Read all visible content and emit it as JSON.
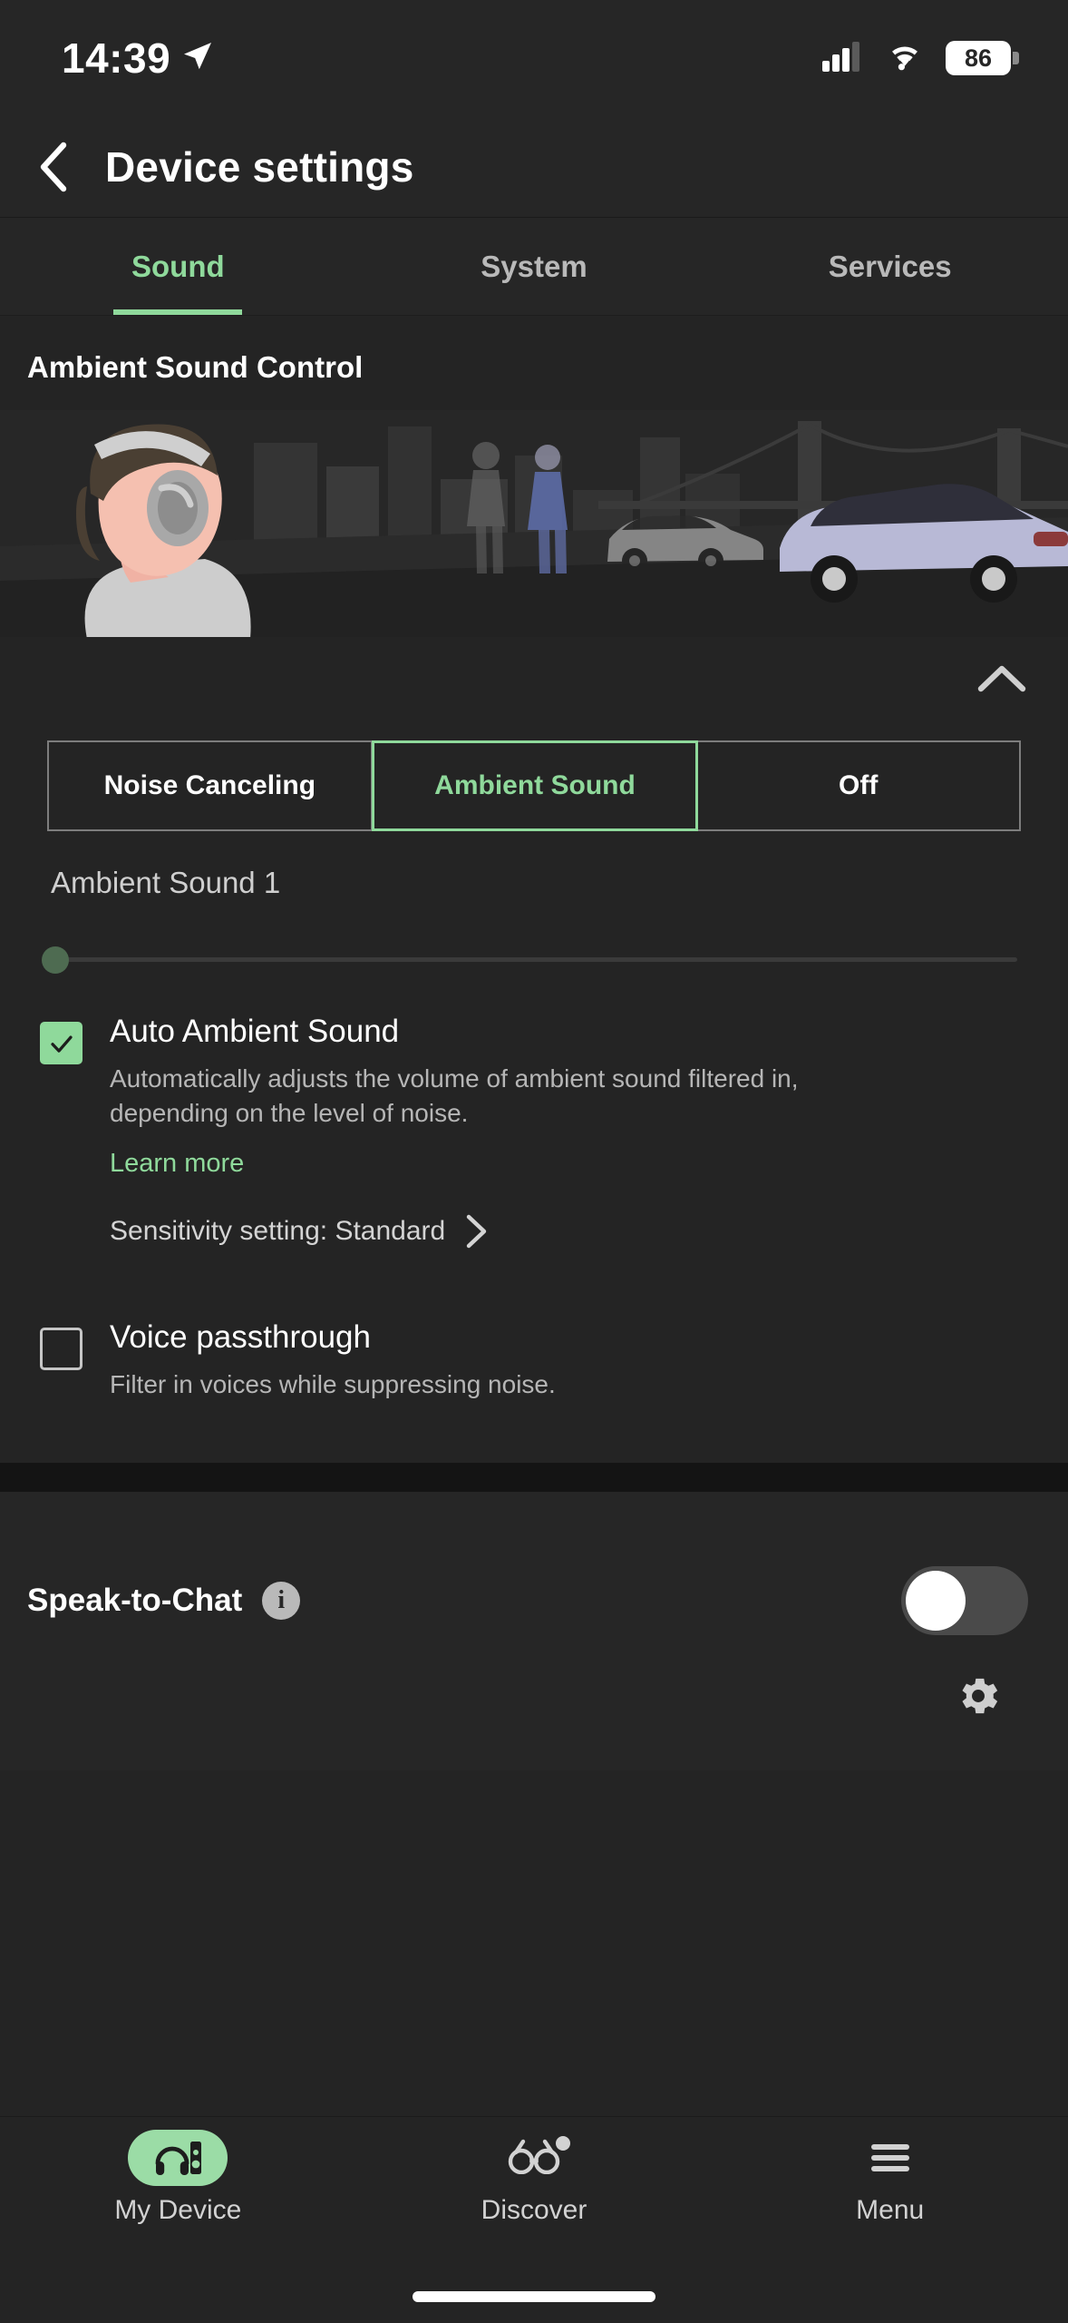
{
  "statusbar": {
    "time": "14:39",
    "location_icon": "location-arrow-icon",
    "cellular_icon": "cellular-bars-icon",
    "wifi_icon": "wifi-icon",
    "battery_level": "86"
  },
  "header": {
    "back_icon": "chevron-left-icon",
    "title": "Device settings"
  },
  "tabs": [
    {
      "label": "Sound",
      "active": true
    },
    {
      "label": "System",
      "active": false
    },
    {
      "label": "Services",
      "active": false
    }
  ],
  "ambient": {
    "section_title": "Ambient Sound Control",
    "collapse_icon": "chevron-up-icon",
    "modes": [
      {
        "label": "Noise Canceling",
        "active": false
      },
      {
        "label": "Ambient Sound",
        "active": true
      },
      {
        "label": "Off",
        "active": false
      }
    ],
    "slider_label": "Ambient Sound 1",
    "slider_value": "1",
    "auto": {
      "checked": true,
      "title": "Auto Ambient Sound",
      "description": "Automatically adjusts the volume of ambient sound filtered in, depending on the level of noise.",
      "learn_more": "Learn more",
      "sensitivity": "Sensitivity setting: Standard",
      "sensitivity_chevron": "chevron-right-icon"
    },
    "voice_passthrough": {
      "checked": false,
      "title": "Voice passthrough",
      "description": "Filter in voices while suppressing noise."
    }
  },
  "speak_to_chat": {
    "title": "Speak-to-Chat",
    "info_icon": "info-icon",
    "info_glyph": "i",
    "toggle_on": false,
    "gear_icon": "gear-icon"
  },
  "bottomnav": [
    {
      "label": "My Device",
      "icon": "headphones-device-icon",
      "active": true
    },
    {
      "label": "Discover",
      "icon": "binoculars-icon",
      "active": false,
      "badge": true
    },
    {
      "label": "Menu",
      "icon": "hamburger-menu-icon",
      "active": false
    }
  ],
  "colors": {
    "accent_green": "#8fd99b",
    "nav_pill_green": "#9bdca6",
    "background": "#242424",
    "surface": "#262626"
  }
}
